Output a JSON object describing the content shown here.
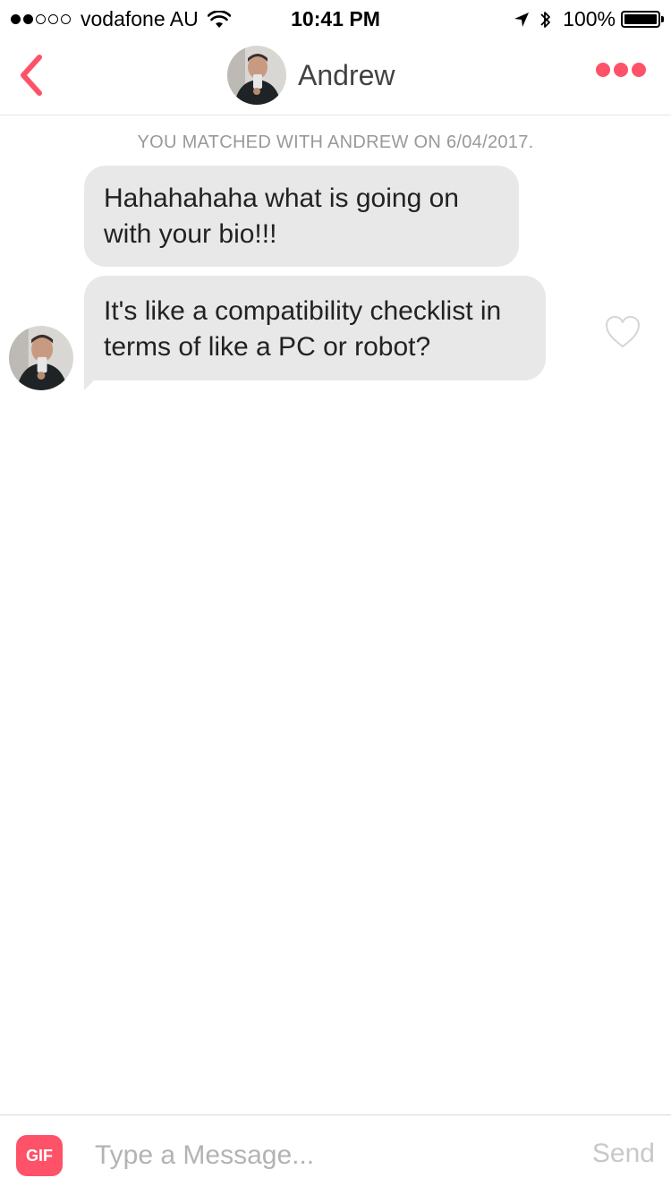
{
  "status_bar": {
    "carrier": "vodafone AU",
    "signal_bars_filled": 2,
    "signal_bars_total": 5,
    "time": "10:41 PM",
    "battery": "100%"
  },
  "header": {
    "name": "Andrew",
    "accent_color": "#fe5268"
  },
  "chat": {
    "match_notice": "YOU MATCHED WITH ANDREW ON 6/04/2017.",
    "messages": [
      {
        "text": "Hahahahaha what is going on with your bio!!!"
      },
      {
        "text": "It's like a compatibility checklist in terms of like a PC or robot?"
      }
    ]
  },
  "composer": {
    "gif_label": "GIF",
    "placeholder": "Type a Message...",
    "send_label": "Send"
  },
  "icons": {
    "back": "chevron-left-icon",
    "more": "more-dots-icon",
    "like": "heart-outline-icon",
    "wifi": "wifi-icon",
    "location": "location-arrow-icon",
    "bluetooth": "bluetooth-icon"
  }
}
